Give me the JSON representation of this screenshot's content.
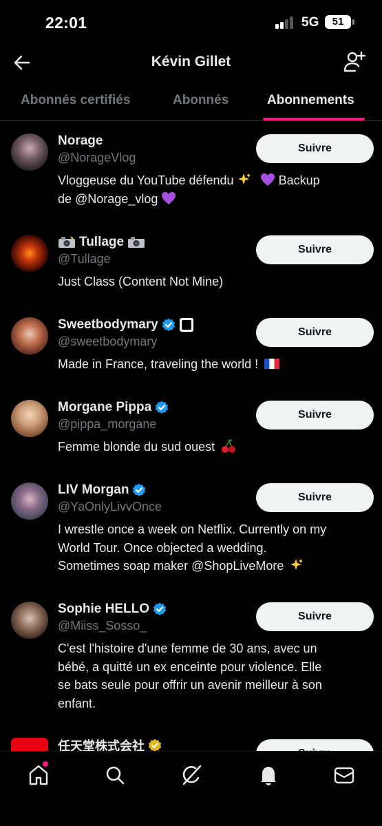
{
  "status_bar": {
    "time": "22:01",
    "network": "5G",
    "battery": "51"
  },
  "header": {
    "title": "Kévin Gillet",
    "back_icon": "arrow-left-icon",
    "add_icon": "add-user-icon"
  },
  "tabs": [
    {
      "label": "Abonnés certifiés",
      "active": false
    },
    {
      "label": "Abonnés",
      "active": false
    },
    {
      "label": "Abonnements",
      "active": true
    }
  ],
  "accent_color": "#f91880",
  "verified_color": "#1d9bf0",
  "users": [
    {
      "name": "Norage",
      "handle": "@NorageVlog",
      "verified": false,
      "bio_lines": [
        "Vloggeuse du YouTube défendu",
        "de @Norage_vlog"
      ],
      "follow_label": "Suivre"
    },
    {
      "name": "Tullage",
      "handle": "@Tullage",
      "verified": false,
      "bio_lines": [
        "Just Class (Content Not Mine)"
      ],
      "follow_label": "Suivre"
    },
    {
      "name": "Sweetbodymary",
      "handle": "@sweetbodymary",
      "verified": true,
      "bio_lines": [
        "Made in France, traveling the world !"
      ],
      "follow_label": "Suivre"
    },
    {
      "name": "Morgane Pippa",
      "handle": "@pippa_morgane",
      "verified": true,
      "bio_lines": [
        "Femme blonde du sud ouest"
      ],
      "follow_label": "Suivre"
    },
    {
      "name": "LIV Morgan",
      "handle": "@YaOnlyLivvOnce",
      "verified": true,
      "bio_lines": [
        "I wrestle once a week on Netflix. Currently on my",
        "World Tour. Once objected a wedding.",
        "Sometimes soap maker @ShopLiveMore"
      ],
      "follow_label": "Suivre"
    },
    {
      "name": "Sophie HELLO",
      "handle": "@Miiss_Sosso_",
      "verified": true,
      "bio_lines": [
        "C'est l'histoire d'une femme de 30 ans, avec un",
        "bébé, a quitté un ex enceinte pour violence. Elle",
        "se bats seule pour offrir un avenir meilleur à son",
        "enfant."
      ],
      "follow_label": "Suivre"
    },
    {
      "name": "任天堂株式会社",
      "handle": "",
      "verified": true,
      "bio_lines": [],
      "follow_label": "Suivre"
    }
  ],
  "extra_text": {
    "backup": "Backup"
  },
  "bottom_nav": [
    {
      "icon": "home-icon",
      "has_notification": true
    },
    {
      "icon": "search-icon",
      "has_notification": false
    },
    {
      "icon": "grok-icon",
      "has_notification": false
    },
    {
      "icon": "bell-icon",
      "has_notification": false
    },
    {
      "icon": "mail-icon",
      "has_notification": false
    }
  ]
}
